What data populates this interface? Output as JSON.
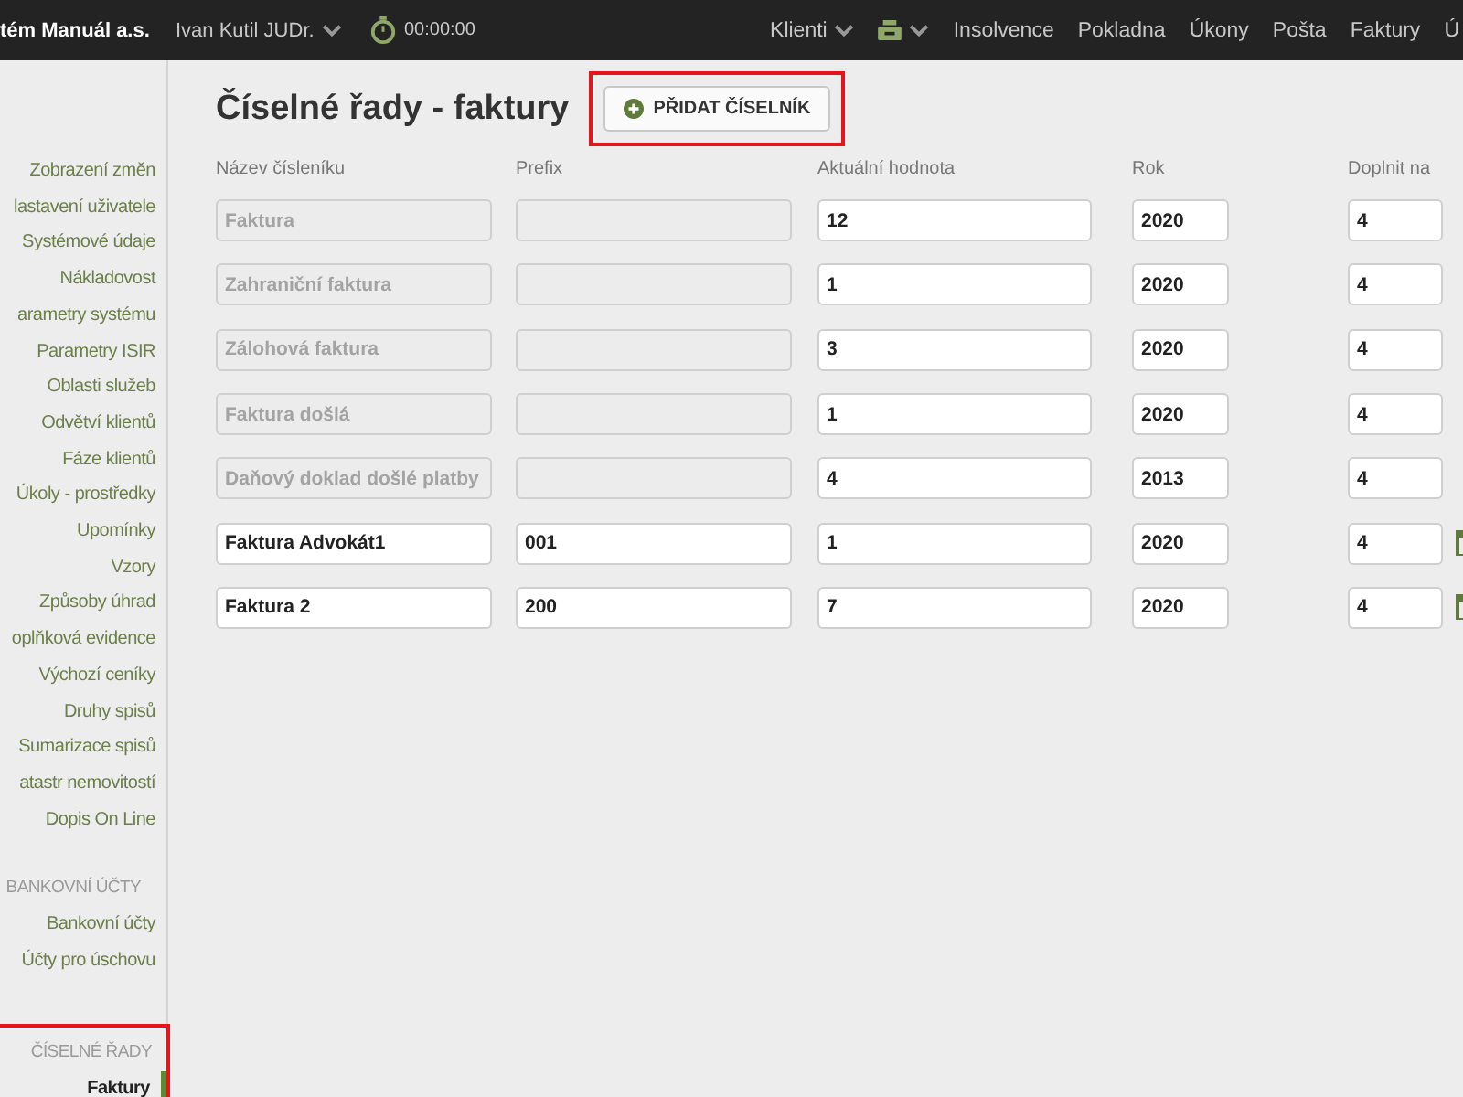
{
  "topbar": {
    "brand": "tém Manuál a.s.",
    "user": "Ivan Kutil JUDr.",
    "timer": "00:00:00",
    "nav": [
      {
        "kind": "dropdown",
        "label": "Klienti"
      },
      {
        "kind": "icon-dropdown"
      },
      {
        "kind": "link",
        "label": "Insolvence"
      },
      {
        "kind": "link",
        "label": "Pokladna"
      },
      {
        "kind": "link",
        "label": "Úkony"
      },
      {
        "kind": "link",
        "label": "Pošta"
      },
      {
        "kind": "link",
        "label": "Faktury"
      },
      {
        "kind": "link",
        "label": "Ú"
      }
    ]
  },
  "sidebar": {
    "sections": [
      {
        "items": [
          {
            "label": "Zobrazení změn",
            "selected": false
          },
          {
            "label": "lastavení uživatele",
            "selected": false
          },
          {
            "label": "Systémové údaje",
            "selected": false
          },
          {
            "label": "Nákladovost",
            "selected": false
          },
          {
            "label": "arametry systému",
            "selected": false
          },
          {
            "label": "Parametry ISIR",
            "selected": false
          },
          {
            "label": "Oblasti služeb",
            "selected": false
          },
          {
            "label": "Odvětví klientů",
            "selected": false
          },
          {
            "label": "Fáze klientů",
            "selected": false
          },
          {
            "label": "Úkoly - prostředky",
            "selected": false
          },
          {
            "label": "Upomínky",
            "selected": false
          },
          {
            "label": "Vzory",
            "selected": false
          },
          {
            "label": "Způsoby úhrad",
            "selected": false
          },
          {
            "label": "oplňková evidence",
            "selected": false
          },
          {
            "label": "Výchozí ceníky",
            "selected": false
          },
          {
            "label": "Druhy spisů",
            "selected": false
          },
          {
            "label": "Sumarizace spisů",
            "selected": false
          },
          {
            "label": "atastr nemovitostí",
            "selected": false
          },
          {
            "label": "Dopis On Line",
            "selected": false
          }
        ]
      },
      {
        "heading": "BANKOVNÍ ÚČTY",
        "items": [
          {
            "label": "Bankovní účty",
            "selected": false
          },
          {
            "label": "Účty pro úschovu",
            "selected": false
          }
        ]
      },
      {
        "heading": "ČÍSELNÉ ŘADY",
        "highlighted": true,
        "items": [
          {
            "label": "Faktury",
            "selected": true
          }
        ]
      }
    ]
  },
  "page": {
    "title": "Číselné řady - faktury",
    "add_button": {
      "label": "PŘIDAT ČÍSELNÍK",
      "highlighted": true
    }
  },
  "table": {
    "columns": [
      "Název čísleníku",
      "Prefix",
      "Aktuální hodnota",
      "Rok",
      "Doplnit na"
    ],
    "rows": [
      {
        "name": "Faktura",
        "prefix": "",
        "value": "12",
        "year": "2020",
        "pad": "4",
        "disabled": true,
        "deletable": false
      },
      {
        "name": "Zahraniční faktura",
        "prefix": "",
        "value": "1",
        "year": "2020",
        "pad": "4",
        "disabled": true,
        "deletable": false
      },
      {
        "name": "Zálohová faktura",
        "prefix": "",
        "value": "3",
        "year": "2020",
        "pad": "4",
        "disabled": true,
        "deletable": false
      },
      {
        "name": "Faktura došlá",
        "prefix": "",
        "value": "1",
        "year": "2020",
        "pad": "4",
        "disabled": true,
        "deletable": false
      },
      {
        "name": "Daňový doklad došlé platby",
        "prefix": "",
        "value": "4",
        "year": "2013",
        "pad": "4",
        "disabled": true,
        "deletable": false
      },
      {
        "name": "Faktura Advokát1",
        "prefix": "001",
        "value": "1",
        "year": "2020",
        "pad": "4",
        "disabled": false,
        "deletable": true
      },
      {
        "name": "Faktura 2",
        "prefix": "200",
        "value": "7",
        "year": "2020",
        "pad": "4",
        "disabled": false,
        "deletable": true
      }
    ]
  }
}
